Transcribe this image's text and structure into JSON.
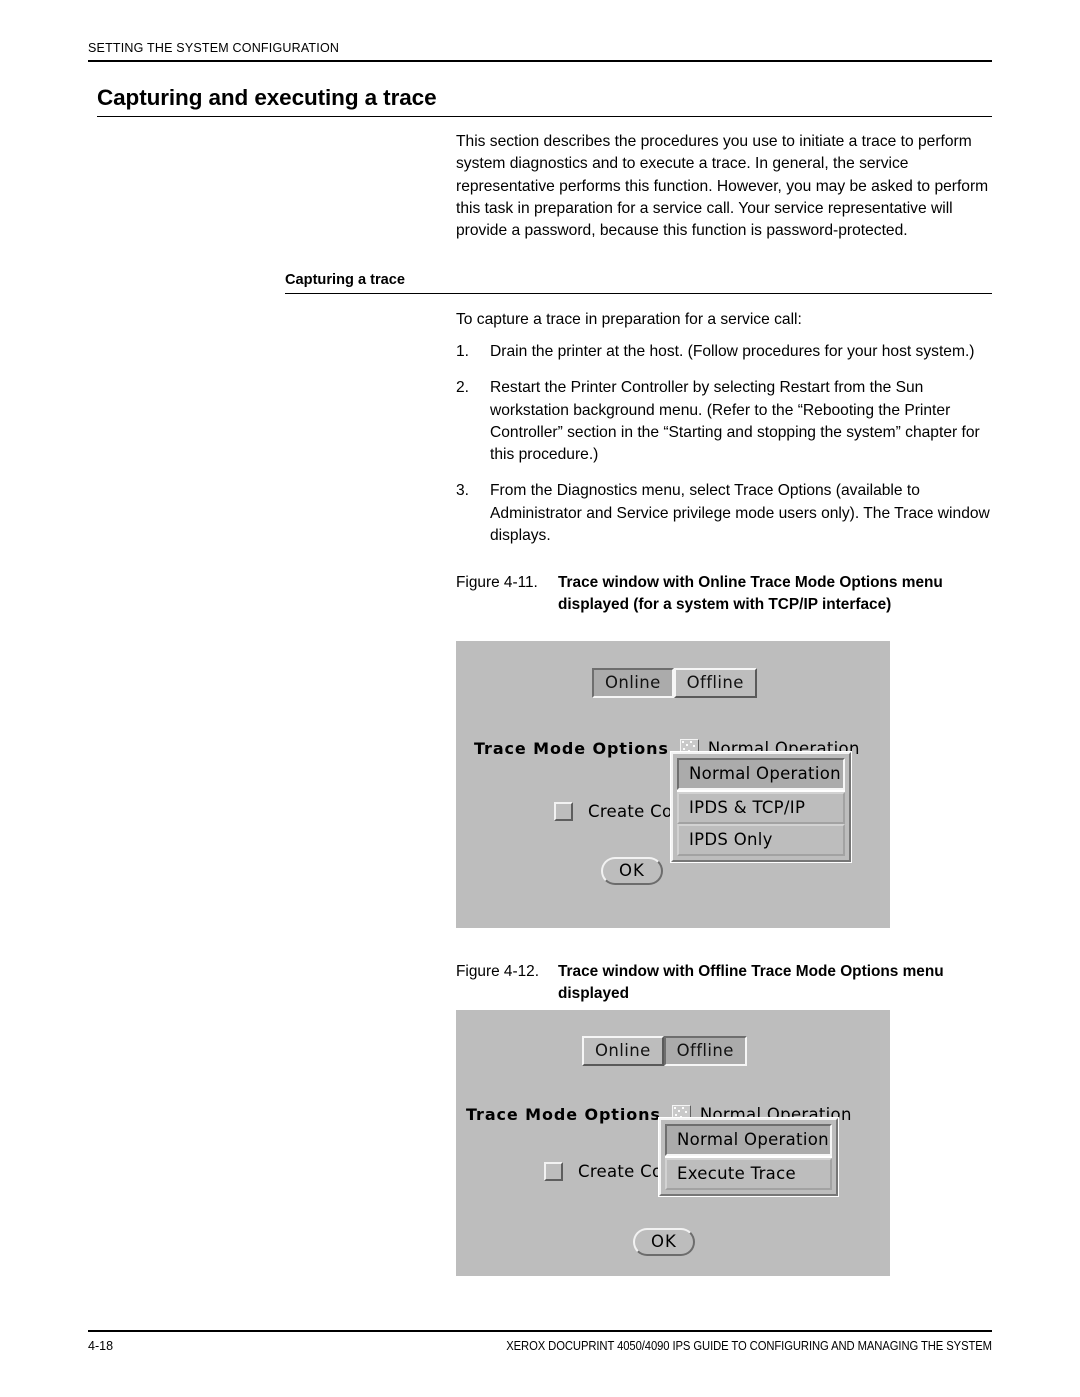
{
  "running_header": "SETTING THE SYSTEM CONFIGURATION",
  "page_title": "Capturing and executing a trace",
  "intro_paragraph": "This section describes the procedures you use to initiate a trace to perform system diagnostics and to execute a trace. In general, the service representative performs this function. However, you may be asked to perform this task in preparation for a service call. Your service representative will provide a password, because this function is password-protected.",
  "subhead": "Capturing a trace",
  "lead_in": "To capture a trace in preparation for a service call:",
  "steps": [
    {
      "num": "1.",
      "text": "Drain the printer at the host. (Follow procedures for your host system.)"
    },
    {
      "num": "2.",
      "text": "Restart the Printer Controller by selecting Restart from the Sun workstation background menu. (Refer to the “Rebooting the Printer Controller” section in the “Starting and stopping the system” chapter for this procedure.)"
    },
    {
      "num": "3.",
      "text": "From the Diagnostics menu, select Trace Options (available to Administrator and Service privilege mode users only). The Trace window displays."
    }
  ],
  "figure_1": {
    "caption_number": "Figure 4-11.",
    "caption_title": "Trace window with Online Trace Mode Options menu displayed (for a system with TCP/IP interface)",
    "online_label": "Online",
    "offline_label": "Offline",
    "selected_toggle": "Online",
    "trace_mode_options_label": "Trace Mode Options",
    "menu_glyph_name": "menu-indicator-icon",
    "trace_mode_value": "Normal Operation",
    "checkbox_label": "Create Com",
    "checkbox_checked": false,
    "dropdown_items": [
      "Normal Operation",
      "IPDS & TCP/IP",
      "IPDS Only"
    ],
    "dropdown_highlighted": "Normal Operation",
    "ok_label": "OK"
  },
  "figure_2": {
    "caption_number": "Figure 4-12.",
    "caption_title": "Trace window with Offline Trace Mode Options menu displayed",
    "online_label": "Online",
    "offline_label": "Offline",
    "selected_toggle": "Offline",
    "trace_mode_options_label": "Trace Mode Options",
    "menu_glyph_name": "menu-indicator-icon",
    "trace_mode_value": "Normal Operation",
    "checkbox_label": "Create Com",
    "checkbox_checked": false,
    "dropdown_items": [
      "Normal Operation",
      "Execute Trace"
    ],
    "dropdown_highlighted": "Normal Operation",
    "ok_label": "OK"
  },
  "footer": {
    "page_number": "4-18",
    "book_title": "XEROX DOCUPRINT 4050/4090 IPS GUIDE TO CONFIGURING AND MANAGING THE SYSTEM"
  },
  "colors": {
    "panel_background": "#bdbdbd",
    "page_background": "#ffffff",
    "text": "#000000"
  }
}
